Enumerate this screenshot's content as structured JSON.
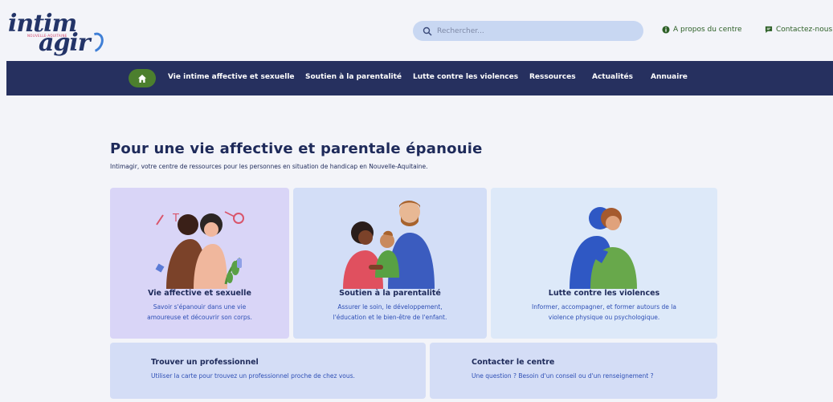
{
  "logo": {
    "line1": "intim",
    "line2": "agir",
    "tagline": "NOUVELLE-AQUITAINE"
  },
  "header": {
    "search_placeholder": "Rechercher...",
    "about_label": "A propos du centre",
    "contact_label": "Contactez-nous"
  },
  "nav": {
    "items": [
      {
        "label": "Vie intime affective et sexuelle"
      },
      {
        "label": "Soutien à la parentalité"
      },
      {
        "label": "Lutte contre les violences"
      },
      {
        "label": "Ressources"
      },
      {
        "label": "Actualités"
      },
      {
        "label": "Annuaire"
      }
    ]
  },
  "main": {
    "title": "Pour une vie affective et parentale épanouie",
    "subtitle": "Intimagir, votre centre de ressources pour les personnes en situation de handicap en Nouvelle-Aquitaine."
  },
  "cards": [
    {
      "title": "Vie affective et sexuelle",
      "desc_line1": "Savoir s'épanouir dans une vie",
      "desc_line2": "amoureuse et découvrir son corps."
    },
    {
      "title": "Soutien à la parentalité",
      "desc_line1": "Assurer le soin, le développement,",
      "desc_line2": "l'éducation et le bien-être de l'enfant."
    },
    {
      "title": "Lutte contre les violences",
      "desc_line1": "Informer, accompagner, et former autours de la",
      "desc_line2": "violence physique ou psychologique."
    }
  ],
  "wide_cards": [
    {
      "title": "Trouver un professionnel",
      "desc": "Utiliser la carte pour trouvez un professionnel proche de chez vous."
    },
    {
      "title": "Contacter le centre",
      "desc": "Une question ? Besoin d'un conseil ou d'un renseignement ?"
    }
  ],
  "colors": {
    "nav_bg": "#26305f",
    "home_bg": "#4c7f2e",
    "search_bg": "#c8d7f2",
    "link_green": "#2c5f26",
    "desc_blue": "#2e4fb5"
  }
}
